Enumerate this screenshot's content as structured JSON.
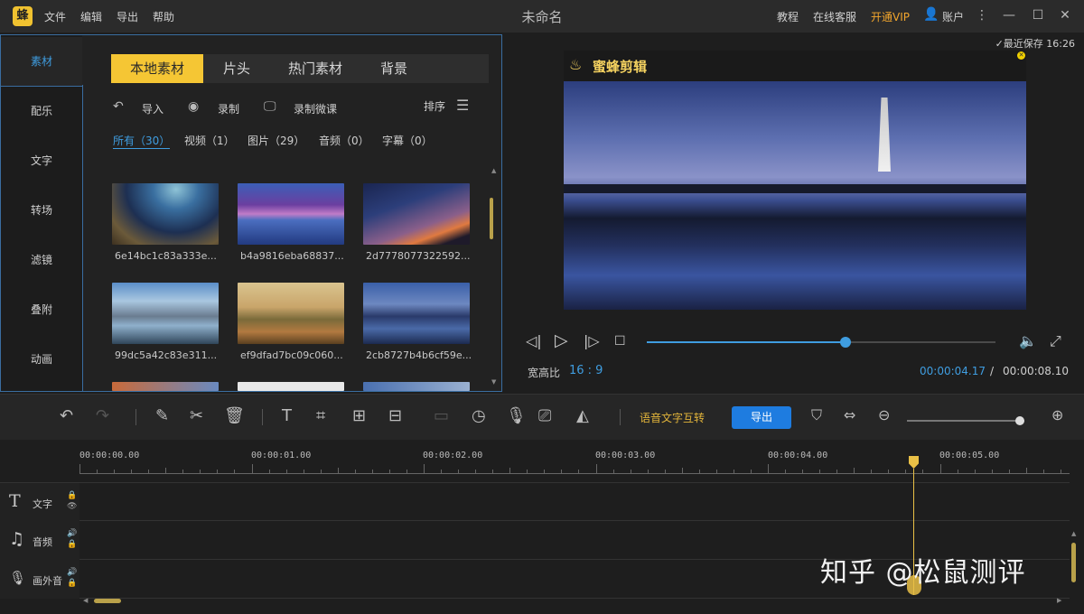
{
  "titlebar": {
    "logo": "蜂",
    "menus": [
      "文件",
      "编辑",
      "导出",
      "帮助"
    ],
    "app_title": "未命名",
    "links": [
      "教程",
      "在线客服",
      "开通VIP",
      "账户"
    ]
  },
  "nav": [
    "素材",
    "配乐",
    "文字",
    "转场",
    "滤镜",
    "叠附",
    "动画"
  ],
  "tabs": [
    "本地素材",
    "片头",
    "热门素材",
    "背景"
  ],
  "tools": {
    "import": "导入",
    "record": "录制",
    "record_lesson": "录制微课",
    "sort": "排序"
  },
  "filters": [
    "所有（30）",
    "视频（1）",
    "图片（29）",
    "音频（0）",
    "字幕（0）"
  ],
  "media": [
    {
      "name": "6e14bc1c83a333e..."
    },
    {
      "name": "b4a9816eba68837..."
    },
    {
      "name": "2d7778077322592..."
    },
    {
      "name": "99dc5a42c83e311..."
    },
    {
      "name": "ef9dfad7bc09c060..."
    },
    {
      "name": "2cb8727b4b6cf59e..."
    }
  ],
  "preview": {
    "save_status": "✓最近保存 16:26",
    "brand": "蜜蜂剪辑",
    "ratio_label": "宽高比",
    "ratio_value": "16 : 9",
    "current_time": "00:00:04.17",
    "separator": "/",
    "total_time": "00:00:08.10",
    "progress": 0.57
  },
  "timeline": {
    "speech_to_text": "语音文字互转",
    "export_label": "导出",
    "zoom_level": 0.96,
    "ruler": [
      "00:00:00.00",
      "00:00:01.00",
      "00:00:02.00",
      "00:00:03.00",
      "00:00:04.00",
      "00:00:05.00"
    ],
    "tracks": [
      {
        "label": "文字",
        "icon": "T"
      },
      {
        "label": "音频",
        "icon": "♫"
      },
      {
        "label": "画外音",
        "icon": "🎙"
      }
    ],
    "watermark": "知乎 @松鼠测评"
  }
}
